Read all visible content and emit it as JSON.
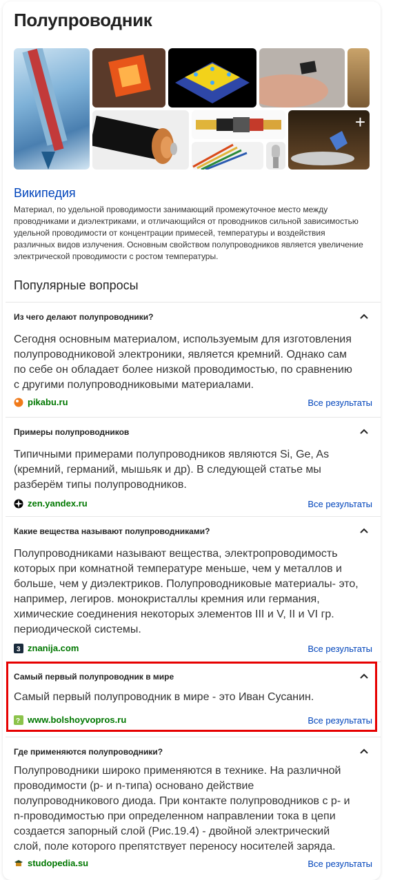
{
  "header": {
    "title": "Полупроводник"
  },
  "gallery": {
    "more_label": "+"
  },
  "wiki": {
    "link_label": "Википедия",
    "text": "Материал, по удельной проводимости занимающий промежуточное место между проводниками и диэлектриками, и отличающийся от проводников сильной зависимостью удельной проводимости от концентрации примесей, температуры и воздействия различных видов излучения. Основным свойством полупроводников является увеличение электрической проводимости с ростом температуры."
  },
  "popular": {
    "title": "Популярные вопросы",
    "all_results_label": "Все результаты",
    "items": [
      {
        "question": "Из чего делают полупроводники?",
        "answer": "Сегодня основным материалом, используемым для изготовления полупроводниковой электроники, является кремний. Однако сам по себе он обладает более низкой проводимостью, по сравнению с другими полупроводниковыми материалами.",
        "source": "pikabu.ru",
        "icon": "pikabu-icon",
        "icon_color": "#f07a1a"
      },
      {
        "question": "Примеры полупроводников",
        "answer": "Типичными примерами полупроводников являются Si, Ge, As (кремний, германий, мышьяк и др). В следующей статье мы разберём типы полупроводников.",
        "source": "zen.yandex.ru",
        "icon": "zen-icon",
        "icon_color": "#000000"
      },
      {
        "question": "Какие вещества называют полупроводниками?",
        "answer": "Полупроводниками называют вещества, электропроводимость которых при комнатной температуре меньше, чем у металлов и больше, чем у диэлектриков. Полупроводниковые материалы- это, например, легиров. монокристаллы кремния или германия, химические соединения некоторых элементов III и V, II и VI гр. периодической системы.",
        "source": "znanija.com",
        "icon": "znanija-icon",
        "icon_color": "#1a2b3c"
      },
      {
        "question": "Самый первый полупроводник в мире",
        "answer": "Самый первый полупроводник в мире - это Иван Сусанин.",
        "source": "www.bolshoyvopros.ru",
        "icon": "bolshoyvopros-icon",
        "icon_color": "#8bc34a"
      },
      {
        "question": "Где применяются полупроводники?",
        "answer": "Полупроводники широко применяются в технике. На различной проводимости (p- и n-типа) основано действие полупроводникового диода. При контакте полупроводников с p- и n-проводимостью при определенном направлении тока в цепи создается запорный слой (Рис.19.4) - двойной электрический слой, поле которого препятствует переносу носителей заряда.",
        "source": "studopedia.su",
        "icon": "studopedia-icon",
        "icon_color": "#c98a1a"
      }
    ]
  },
  "colors": {
    "link": "#0044bb",
    "source": "#007700",
    "highlight": "#e60000"
  }
}
